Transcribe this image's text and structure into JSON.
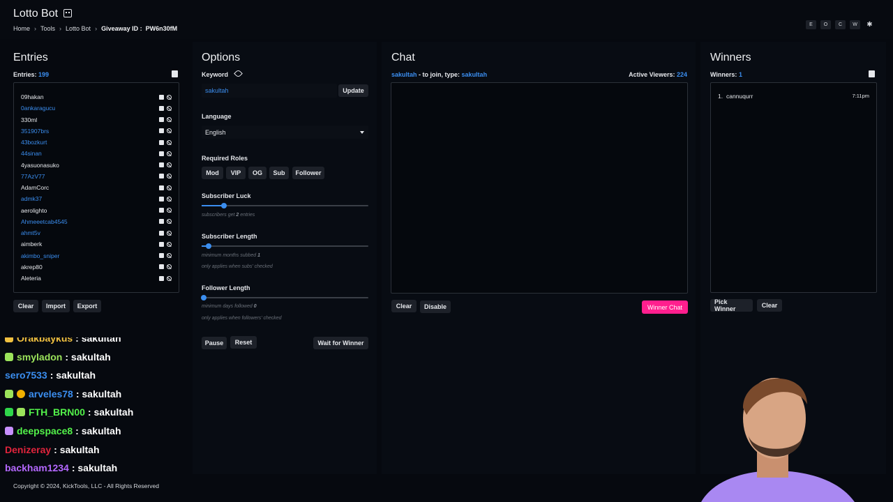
{
  "app": {
    "title": "Lotto Bot"
  },
  "breadcrumb": {
    "home": "Home",
    "tools": "Tools",
    "bot": "Lotto Bot",
    "giveaway_label": "Giveaway ID :",
    "giveaway_id": "PW6n30fM"
  },
  "top_actions": [
    "E",
    "O",
    "C",
    "W",
    "✱"
  ],
  "entries": {
    "title": "Entries",
    "count_label": "Entries:",
    "count": "199",
    "items": [
      {
        "name": "09hakan",
        "color": "#e6e8ec"
      },
      {
        "name": "0ankaragucu",
        "color": "#3b8ef0"
      },
      {
        "name": "330ml",
        "color": "#e6e8ec"
      },
      {
        "name": "351907brs",
        "color": "#3b8ef0"
      },
      {
        "name": "43bozkurt",
        "color": "#3b8ef0"
      },
      {
        "name": "44sinan",
        "color": "#3b8ef0"
      },
      {
        "name": "4yasuonasuko",
        "color": "#e6e8ec"
      },
      {
        "name": "77AzV77",
        "color": "#3b8ef0"
      },
      {
        "name": "AdamCorc",
        "color": "#e6e8ec"
      },
      {
        "name": "admk37",
        "color": "#3b8ef0"
      },
      {
        "name": "aerolighto",
        "color": "#e6e8ec"
      },
      {
        "name": "Ahmeeetcab4545",
        "color": "#3b8ef0"
      },
      {
        "name": "ahmt5v",
        "color": "#3b8ef0"
      },
      {
        "name": "aimberk",
        "color": "#e6e8ec"
      },
      {
        "name": "akimbo_sniper",
        "color": "#3b8ef0"
      },
      {
        "name": "akrep80",
        "color": "#e6e8ec"
      },
      {
        "name": "Aleteria",
        "color": "#e6e8ec"
      }
    ],
    "buttons": {
      "clear": "Clear",
      "import": "Import",
      "export": "Export"
    }
  },
  "options": {
    "title": "Options",
    "keyword_label": "Keyword",
    "keyword_value": "sakultah",
    "update": "Update",
    "language_label": "Language",
    "language_value": "English",
    "roles_label": "Required Roles",
    "roles": [
      "Mod",
      "VIP",
      "OG",
      "Sub",
      "Follower"
    ],
    "sub_luck_label": "Subscriber Luck",
    "sub_luck_hint_pre": "subscribers get",
    "sub_luck_value": "2",
    "sub_luck_hint_post": "entries",
    "sub_luck_fraction": 0.12,
    "sub_len_label": "Subscriber Length",
    "sub_len_hint_pre": "minimum months subbed",
    "sub_len_value": "1",
    "sub_len_hint2": "only applies when subs' checked",
    "sub_len_fraction": 0.03,
    "fol_len_label": "Follower Length",
    "fol_len_hint_pre": "minimum days followed",
    "fol_len_value": "0",
    "fol_len_hint2": "only applies when followers' checked",
    "fol_len_fraction": 0.0,
    "pause": "Pause",
    "reset": "Reset",
    "wait": "Wait for Winner"
  },
  "chat": {
    "title": "Chat",
    "keyword": "sakultah",
    "join_text": "- to join, type:",
    "join_keyword": "sakultah",
    "viewers_label": "Active Viewers:",
    "viewers": "224",
    "clear": "Clear",
    "disable": "Disable",
    "winner_chat": "Winner Chat"
  },
  "winners": {
    "title": "Winners",
    "count_label": "Winners:",
    "count": "1",
    "items": [
      {
        "index": "1.",
        "name": "cannuqurr",
        "time": "7:11pm"
      }
    ],
    "pick": "Pick Winner",
    "clear": "Clear"
  },
  "feed": [
    {
      "user": "Orakbaykus",
      "msg": ": sakultah",
      "color": "#f0c040",
      "badges": [
        "crown"
      ]
    },
    {
      "user": "smyladon",
      "msg": ": sakultah",
      "color": "#9be35b",
      "badges": [
        "gift"
      ]
    },
    {
      "user": "sero7533",
      "msg": ": sakultah",
      "color": "#3b8ef0",
      "badges": []
    },
    {
      "user": "arveles78",
      "msg": ": sakultah",
      "color": "#3b8ef0",
      "badges": [
        "gift",
        "coin"
      ]
    },
    {
      "user": "FTH_BRN00",
      "msg": ": sakultah",
      "color": "#53f24a",
      "badges": [
        "cube",
        "gift"
      ]
    },
    {
      "user": "deepspace8",
      "msg": ": sakultah",
      "color": "#53f24a",
      "badges": [
        "gem"
      ]
    },
    {
      "user": "Denizeray",
      "msg": ": sakultah",
      "color": "#e0243c",
      "badges": []
    },
    {
      "user": "backham1234",
      "msg": ": sakultah",
      "color": "#b468ff",
      "badges": []
    }
  ],
  "footer": "Copyright © 2024, KickTools, LLC - All Rights Reserved"
}
